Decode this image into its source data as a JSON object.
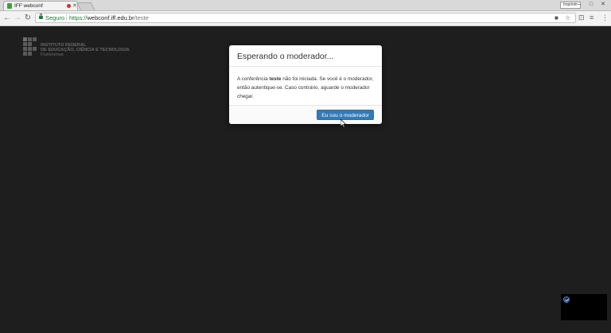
{
  "browser": {
    "tab": {
      "title": "IFF webconf",
      "close_glyph": "✕",
      "favicon": "leaf-favicon-icon",
      "recording_color": "#d93025"
    },
    "profile_badge": "Imprimir",
    "window_controls": [
      "–",
      "□",
      "✕"
    ],
    "nav": {
      "back": "←",
      "forward": "→",
      "reload": "↻"
    },
    "omnibox": {
      "secure_label": "Seguro",
      "url_scheme": "https://",
      "url_host": "webconf.iff.edu.br",
      "url_path": "/teste"
    },
    "toolbar_icons": [
      "camera-icon",
      "star-icon",
      "extension-icon",
      "screen-share-icon",
      "menu-icon"
    ]
  },
  "page": {
    "logo": {
      "line1": "INSTITUTO FEDERAL",
      "line2": "DE EDUCAÇÃO, CIÊNCIA E TECNOLOGIA",
      "line3": "Fluminense"
    },
    "modal": {
      "title": "Esperando o moderador...",
      "body_prefix": "A conferência ",
      "body_bold": "teste",
      "body_suffix": " não foi iniciada. Se você é o moderador, então autentique-se. Caso contrário, aguarde o moderador chegar.",
      "button_label": "Eu sou o moderador"
    }
  },
  "colors": {
    "page_background": "#1e1e1e",
    "primary_button": "#337ab7",
    "secure_green": "#188038"
  }
}
